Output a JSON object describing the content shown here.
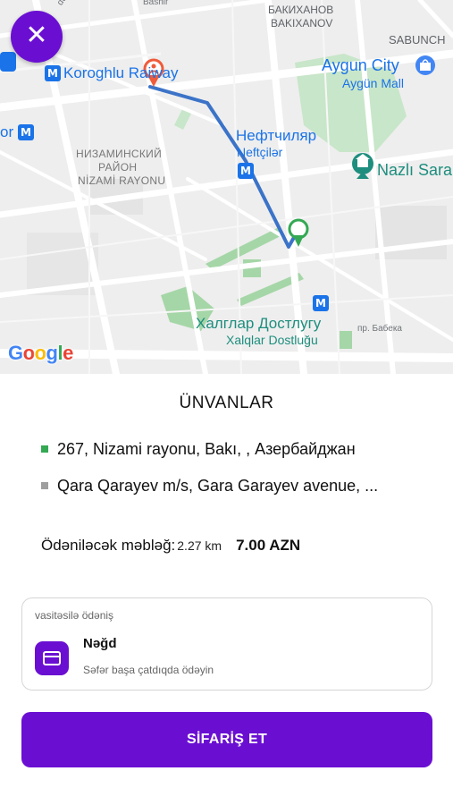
{
  "map": {
    "close_label": "✕",
    "google_logo": [
      {
        "ch": "G",
        "color": "#4285f4"
      },
      {
        "ch": "o",
        "color": "#ea4335"
      },
      {
        "ch": "o",
        "color": "#fbbc05"
      },
      {
        "ch": "g",
        "color": "#4285f4"
      },
      {
        "ch": "l",
        "color": "#34a853"
      },
      {
        "ch": "e",
        "color": "#ea4335"
      }
    ],
    "labels": {
      "koroglu": "Koroghlu Rai",
      "koroglu_tail": "way",
      "bakixanov_ru": "БАКИХАНОВ",
      "bakixanov": "BAKIXANOV",
      "sabunchu": "SABUNCH",
      "aygun_city": "Aygun City",
      "aygun_mall": "Aygün Mall",
      "neftchilar_ru": "Нефтчиляр",
      "neftchilar": "Neftçilər",
      "nazli": "Nazlı Sara",
      "nizami_ru_1": "НИЗАМИНСКИЙ",
      "nizami_ru_2": "РАЙОН",
      "nizami": "NİZAMİ RAYONU",
      "xalglar_ru": "Халглар Достлугу",
      "xalglar": "Xalqlar Dostluğu",
      "babeka": "пр. Бабека",
      "or": "or",
      "top_left": "dar As",
      "top_mid": "Bashir"
    },
    "metro_symbol": "M"
  },
  "sheet": {
    "title": "ÜNVANLAR",
    "addresses": [
      {
        "text": "267, Nizami rayonu, Bakı,  , Азербайджан",
        "color": "#34a853"
      },
      {
        "text": "Qara Qarayev m/s, Gara Garayev avenue, ...",
        "color": "#9e9e9e"
      }
    ],
    "price": {
      "label": "Ödəniləcək məbləğ:",
      "distance": "2.27 km",
      "amount": "7.00 AZN"
    },
    "payment": {
      "header": "vasitəsilə ödəniş",
      "method": "Nəğd",
      "hint": "Səfər başa çatdıqda ödəyin"
    },
    "order_button": "SİFARİŞ ET"
  },
  "colors": {
    "accent": "#6a0fd2",
    "route": "#3b73c8",
    "start_pin": "#ef5b3a",
    "end_pin": "#34a853"
  }
}
